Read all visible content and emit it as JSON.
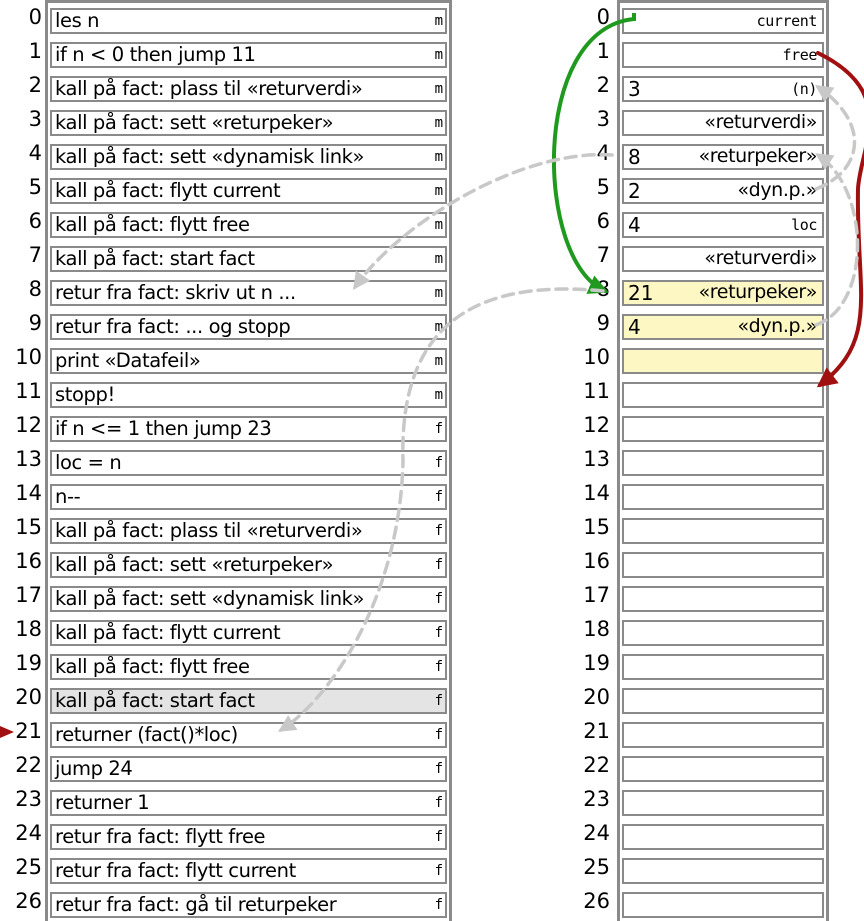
{
  "program": {
    "rows": [
      {
        "index": "0",
        "text": "les n",
        "seg": "m",
        "hl": ""
      },
      {
        "index": "1",
        "text": "if n < 0 then jump 11",
        "seg": "m",
        "hl": ""
      },
      {
        "index": "2",
        "text": "kall på fact: plass til «returverdi»",
        "seg": "m",
        "hl": ""
      },
      {
        "index": "3",
        "text": "kall på fact: sett «returpeker»",
        "seg": "m",
        "hl": ""
      },
      {
        "index": "4",
        "text": "kall på fact: sett «dynamisk link»",
        "seg": "m",
        "hl": ""
      },
      {
        "index": "5",
        "text": "kall på fact: flytt current",
        "seg": "m",
        "hl": ""
      },
      {
        "index": "6",
        "text": "kall på fact: flytt free",
        "seg": "m",
        "hl": ""
      },
      {
        "index": "7",
        "text": "kall på fact: start fact",
        "seg": "m",
        "hl": ""
      },
      {
        "index": "8",
        "text": "retur fra fact: skriv ut n ...",
        "seg": "m",
        "hl": ""
      },
      {
        "index": "9",
        "text": "retur fra fact: ... og stopp",
        "seg": "m",
        "hl": ""
      },
      {
        "index": "10",
        "text": "print «Datafeil»",
        "seg": "m",
        "hl": ""
      },
      {
        "index": "11",
        "text": "stopp!",
        "seg": "m",
        "hl": ""
      },
      {
        "index": "12",
        "text": "if n <= 1 then jump 23",
        "seg": "f",
        "hl": ""
      },
      {
        "index": "13",
        "text": "loc = n",
        "seg": "f",
        "hl": ""
      },
      {
        "index": "14",
        "text": "n--",
        "seg": "f",
        "hl": ""
      },
      {
        "index": "15",
        "text": "kall på fact: plass til «returverdi»",
        "seg": "f",
        "hl": ""
      },
      {
        "index": "16",
        "text": "kall på fact: sett «returpeker»",
        "seg": "f",
        "hl": ""
      },
      {
        "index": "17",
        "text": "kall på fact: sett «dynamisk link»",
        "seg": "f",
        "hl": ""
      },
      {
        "index": "18",
        "text": "kall på fact: flytt current",
        "seg": "f",
        "hl": ""
      },
      {
        "index": "19",
        "text": "kall på fact: flytt free",
        "seg": "f",
        "hl": ""
      },
      {
        "index": "20",
        "text": "kall på fact: start fact",
        "seg": "f",
        "hl": "gray"
      },
      {
        "index": "21",
        "text": "returner (fact()*loc)",
        "seg": "f",
        "hl": ""
      },
      {
        "index": "22",
        "text": "jump 24",
        "seg": "f",
        "hl": ""
      },
      {
        "index": "23",
        "text": "returner 1",
        "seg": "f",
        "hl": ""
      },
      {
        "index": "24",
        "text": "retur fra fact: flytt free",
        "seg": "f",
        "hl": ""
      },
      {
        "index": "25",
        "text": "retur fra fact: flytt current",
        "seg": "f",
        "hl": ""
      },
      {
        "index": "26",
        "text": "retur fra fact: gå til returpeker",
        "seg": "f",
        "hl": ""
      }
    ]
  },
  "memory": {
    "rows": [
      {
        "index": "0",
        "value": "",
        "label": "current",
        "mono": true,
        "hl": ""
      },
      {
        "index": "1",
        "value": "",
        "label": "free",
        "mono": true,
        "hl": ""
      },
      {
        "index": "2",
        "value": "3",
        "label": "(n)",
        "mono": true,
        "hl": ""
      },
      {
        "index": "3",
        "value": "",
        "label": "«returverdi»",
        "mono": false,
        "hl": ""
      },
      {
        "index": "4",
        "value": "8",
        "label": "«returpeker»",
        "mono": false,
        "hl": ""
      },
      {
        "index": "5",
        "value": "2",
        "label": "«dyn.p.»",
        "mono": false,
        "hl": ""
      },
      {
        "index": "6",
        "value": "4",
        "label": "loc",
        "mono": true,
        "hl": ""
      },
      {
        "index": "7",
        "value": "",
        "label": "«returverdi»",
        "mono": false,
        "hl": ""
      },
      {
        "index": "8",
        "value": "21",
        "label": "«returpeker»",
        "mono": false,
        "hl": "yellow"
      },
      {
        "index": "9",
        "value": "4",
        "label": "«dyn.p.»",
        "mono": false,
        "hl": "yellow"
      },
      {
        "index": "10",
        "value": "",
        "label": "",
        "mono": false,
        "hl": "yellow"
      },
      {
        "index": "11",
        "value": "",
        "label": "",
        "mono": false,
        "hl": ""
      },
      {
        "index": "12",
        "value": "",
        "label": "",
        "mono": false,
        "hl": ""
      },
      {
        "index": "13",
        "value": "",
        "label": "",
        "mono": false,
        "hl": ""
      },
      {
        "index": "14",
        "value": "",
        "label": "",
        "mono": false,
        "hl": ""
      },
      {
        "index": "15",
        "value": "",
        "label": "",
        "mono": false,
        "hl": ""
      },
      {
        "index": "16",
        "value": "",
        "label": "",
        "mono": false,
        "hl": ""
      },
      {
        "index": "17",
        "value": "",
        "label": "",
        "mono": false,
        "hl": ""
      },
      {
        "index": "18",
        "value": "",
        "label": "",
        "mono": false,
        "hl": ""
      },
      {
        "index": "19",
        "value": "",
        "label": "",
        "mono": false,
        "hl": ""
      },
      {
        "index": "20",
        "value": "",
        "label": "",
        "mono": false,
        "hl": ""
      },
      {
        "index": "21",
        "value": "",
        "label": "",
        "mono": false,
        "hl": ""
      },
      {
        "index": "22",
        "value": "",
        "label": "",
        "mono": false,
        "hl": ""
      },
      {
        "index": "23",
        "value": "",
        "label": "",
        "mono": false,
        "hl": ""
      },
      {
        "index": "24",
        "value": "",
        "label": "",
        "mono": false,
        "hl": ""
      },
      {
        "index": "25",
        "value": "",
        "label": "",
        "mono": false,
        "hl": ""
      },
      {
        "index": "26",
        "value": "",
        "label": "",
        "mono": false,
        "hl": ""
      }
    ]
  },
  "colors": {
    "green_arrow": "#1f9a1f",
    "red_arrow": "#a01010",
    "gray_arrow": "#c8c8c8",
    "frame": "#8a8a8a",
    "gray_highlight": "#e4e4e4",
    "yellow_highlight": "#fdf7c3"
  },
  "arrows": [
    {
      "name": "current-pointer-arrow",
      "kind": "memory-to-memory",
      "from": "0",
      "to": "8",
      "style": "solid",
      "color": "green"
    },
    {
      "name": "free-pointer-arrow",
      "kind": "memory-to-memory",
      "from": "1",
      "to": "11",
      "style": "solid",
      "color": "red"
    },
    {
      "name": "dynamic-link-arrow-9-to-4",
      "kind": "memory-to-memory",
      "from": "9",
      "to": "4",
      "style": "dashed",
      "color": "gray"
    },
    {
      "name": "dynamic-link-arrow-5-to-2",
      "kind": "memory-to-memory",
      "from": "5",
      "to": "2",
      "style": "dashed",
      "color": "gray"
    },
    {
      "name": "return-pointer-arrow-4-to-8",
      "kind": "memory-to-program",
      "from": "4",
      "to": "8",
      "style": "dashed",
      "color": "gray"
    },
    {
      "name": "return-pointer-arrow-8-to-21",
      "kind": "memory-to-program",
      "from": "8",
      "to": "21",
      "style": "dashed",
      "color": "gray"
    }
  ],
  "program_counter": {
    "points_to": "21",
    "color": "red"
  }
}
